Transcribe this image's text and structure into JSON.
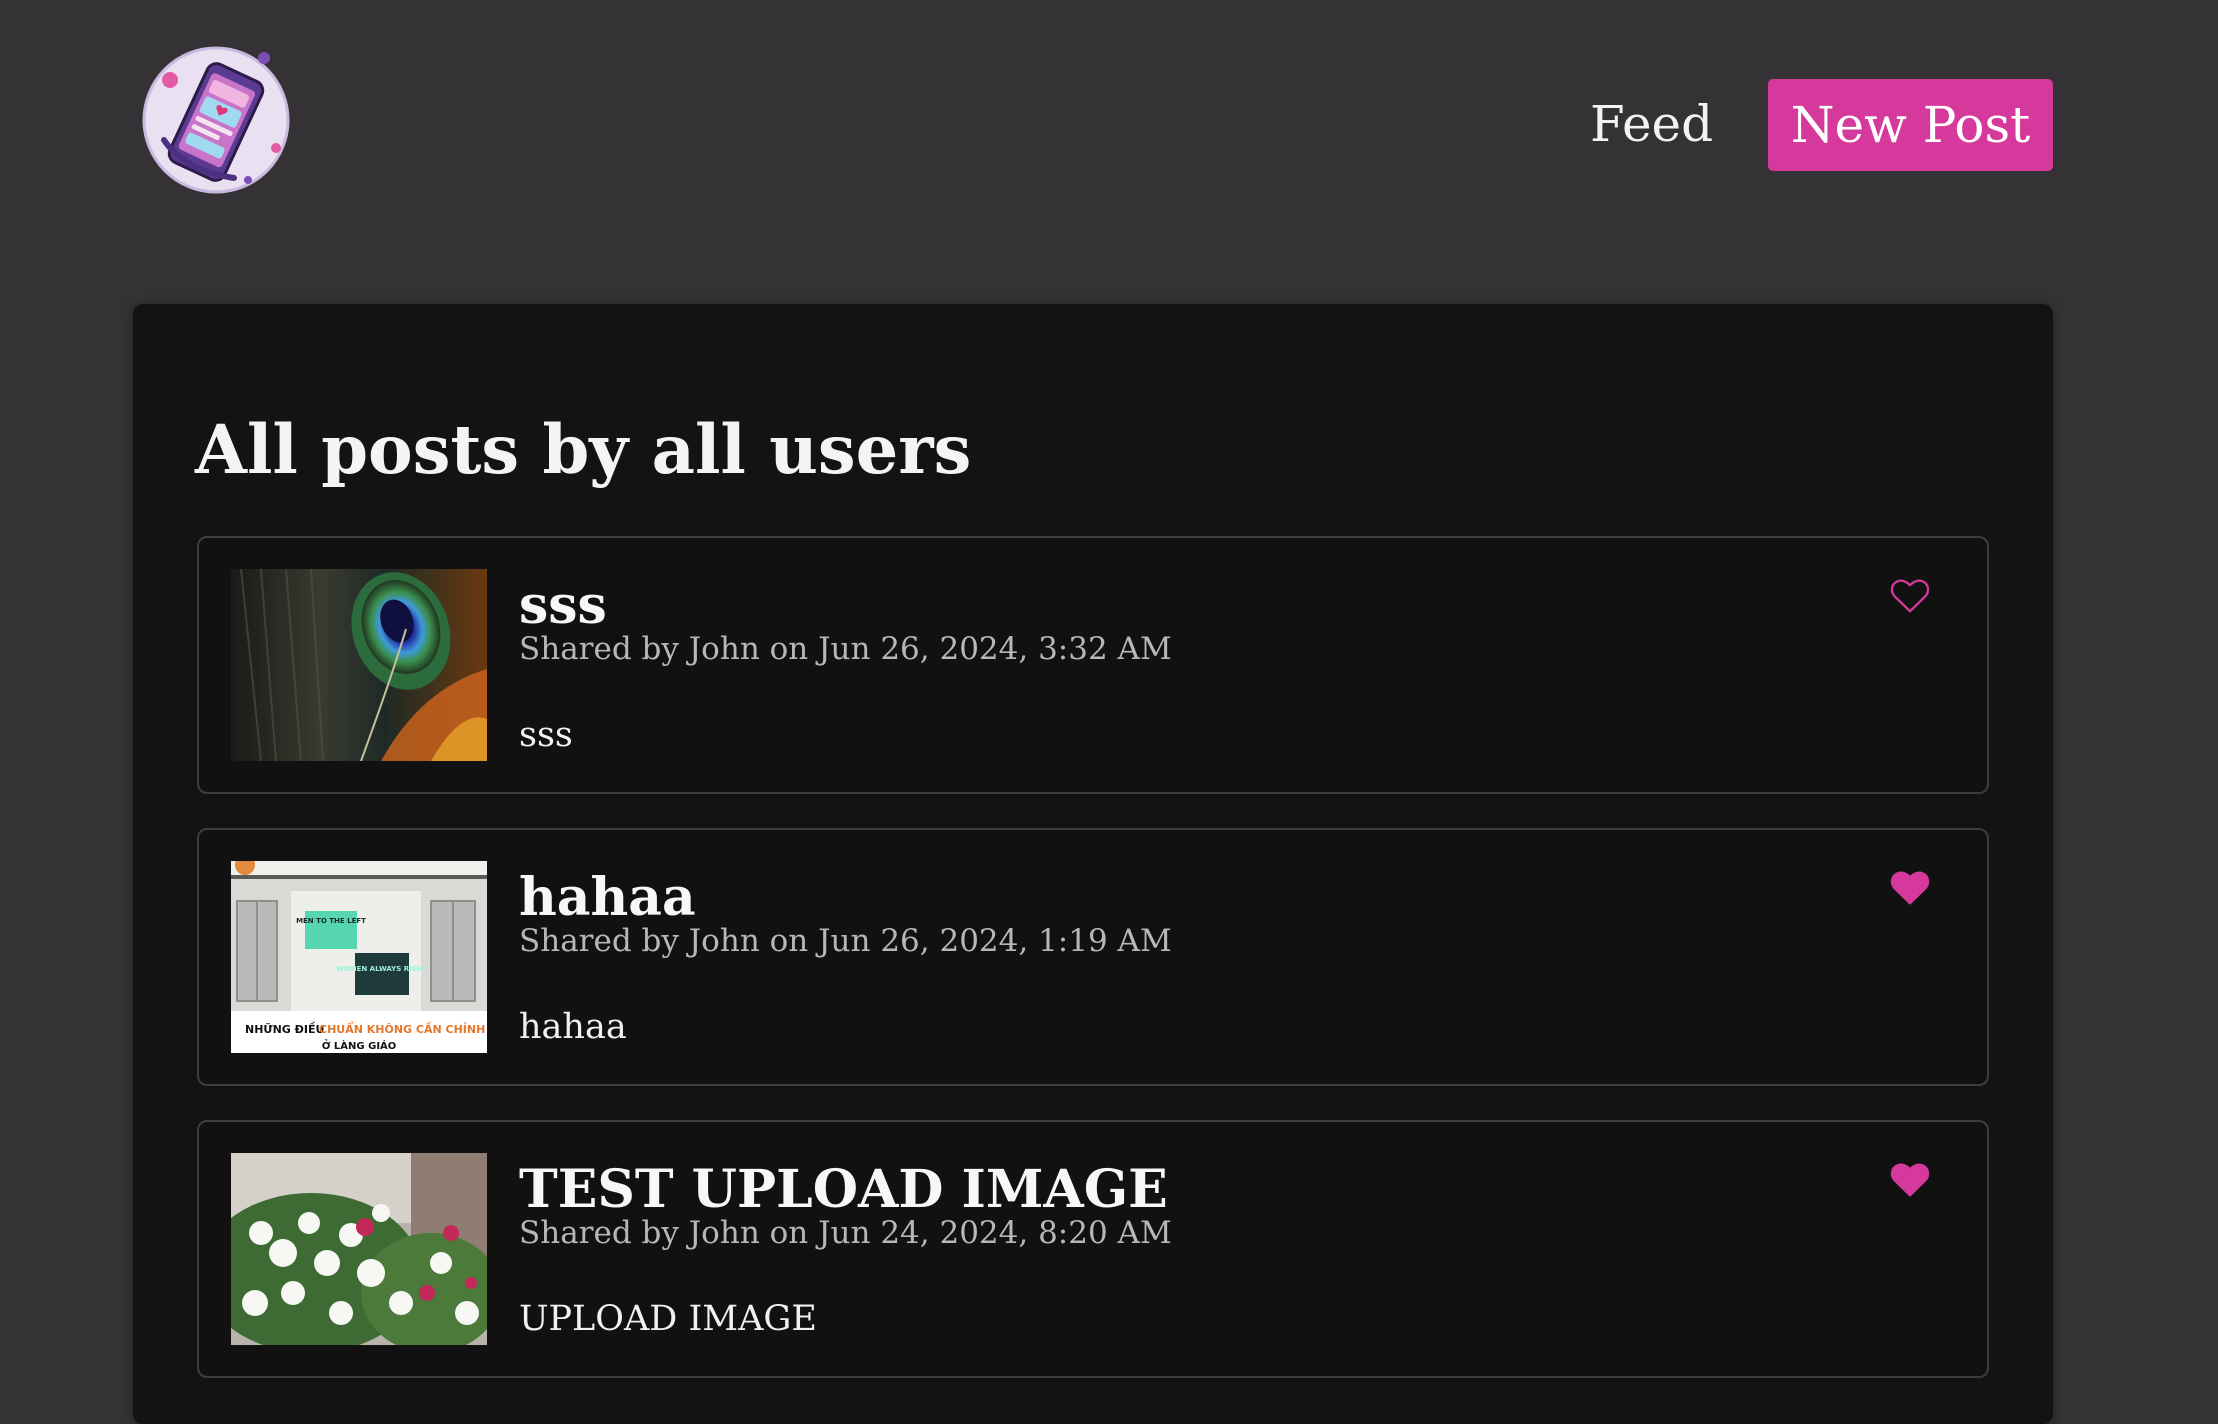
{
  "header": {
    "logo_alt": "app-logo",
    "nav_feed": "Feed",
    "nav_new_post": "New Post"
  },
  "main": {
    "title": "All posts by all users",
    "posts": [
      {
        "title": "sss",
        "meta": "Shared by John on Jun 26, 2024, 3:32 AM",
        "body": "sss",
        "liked": false,
        "thumbnail": "peacock-feather-photo"
      },
      {
        "title": "hahaa",
        "meta": "Shared by John on Jun 26, 2024, 1:19 AM",
        "body": "hahaa",
        "liked": true,
        "thumbnail": "office-lobby-photo",
        "thumb_caption_1": "NHỮNG ĐIỀU",
        "thumb_caption_2": "CHUẨN KHÔNG CẦN CHỈNH",
        "thumb_caption_3": "Ở LÀNG GIÁO",
        "thumb_sign_1": "MEN TO THE LEFT",
        "thumb_sign_2": "WOMEN ALWAYS RIGHT"
      },
      {
        "title": "TEST UPLOAD IMAGE",
        "meta": "Shared by John on Jun 24, 2024, 8:20 AM",
        "body": "UPLOAD IMAGE",
        "liked": true,
        "thumbnail": "white-flowers-photo"
      }
    ]
  },
  "colors": {
    "accent": "#d4399b",
    "background": "#343234",
    "panel": "#141314"
  },
  "icons": {
    "like_empty": "heart-outline-icon",
    "like_filled": "heart-filled-icon"
  }
}
